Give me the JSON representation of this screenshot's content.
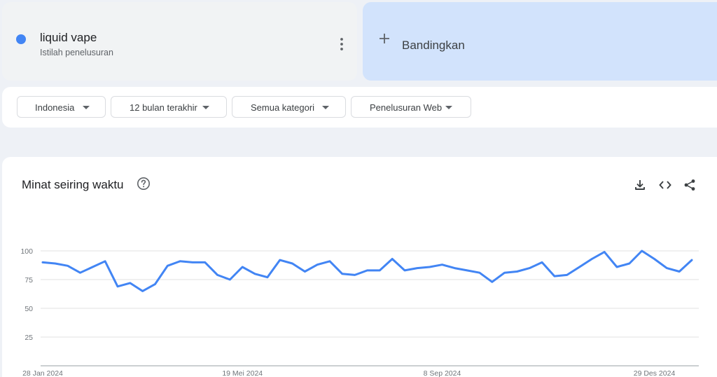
{
  "search_term": {
    "name": "liquid vape",
    "type": "Istilah penelusuran",
    "color": "#4285f4",
    "more_icon": "more-vert-icon"
  },
  "compare": {
    "label": "Bandingkan",
    "icon": "plus-icon"
  },
  "filters": [
    {
      "label": "Indonesia"
    },
    {
      "label": "12 bulan terakhir"
    },
    {
      "label": "Semua kategori"
    },
    {
      "label": "Penelusuran Web"
    }
  ],
  "panel": {
    "title": "Minat seiring waktu",
    "help_icon": "help-icon",
    "tools": [
      "download-icon",
      "embed-code-icon",
      "share-icon"
    ]
  },
  "chart_data": {
    "type": "line",
    "title": "",
    "xlabel": "",
    "ylabel": "",
    "ylim": [
      0,
      100
    ],
    "yticks": [
      25,
      50,
      75,
      100
    ],
    "xticks": [
      "28 Jan 2024",
      "19 Mei 2024",
      "8 Sep 2024",
      "29 Des 2024"
    ],
    "grid": true,
    "line_color": "#4285f4",
    "series": [
      {
        "values": [
          90,
          89,
          87,
          81,
          86,
          91,
          69,
          72,
          65,
          71,
          87,
          91,
          90,
          90,
          79,
          75,
          86,
          80,
          77,
          92,
          89,
          82,
          88,
          91,
          80,
          79,
          83,
          83,
          93,
          83,
          85,
          86,
          88,
          85,
          83,
          81,
          73,
          81,
          82,
          85,
          90,
          78,
          79,
          86,
          93,
          99,
          86,
          89,
          100,
          93,
          85,
          82,
          92
        ]
      }
    ]
  }
}
